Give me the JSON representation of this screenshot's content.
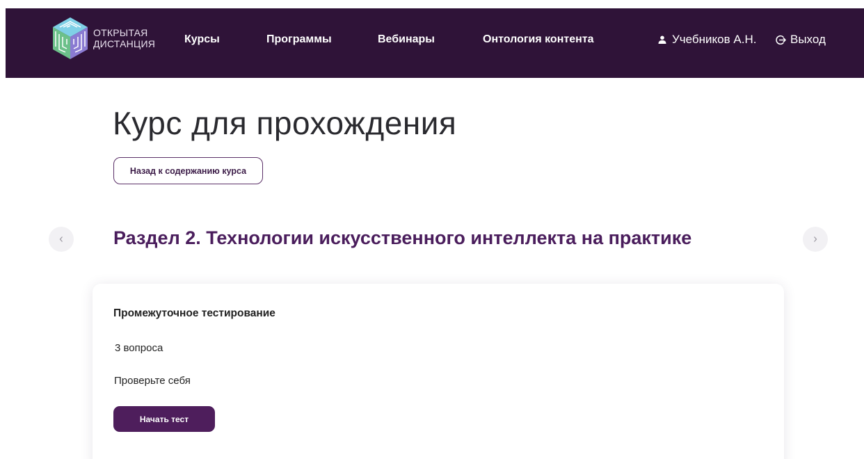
{
  "header": {
    "logo_line1": "Открытая",
    "logo_line2": "дистанция",
    "nav": [
      "Курсы",
      "Программы",
      "Вебинары",
      "Онтология контента"
    ],
    "user_name": "Учебников А.Н.",
    "logout_label": "Выход",
    "background": "#2f1338"
  },
  "page": {
    "title": "Курс для прохождения",
    "back_label": "Назад к содержанию курса",
    "prev_arrow": "‹",
    "next_arrow": "›"
  },
  "section": {
    "title": "Раздел 2. Технологии искусственного интеллекта на практике",
    "accent": "#4a1d5c"
  },
  "card": {
    "title": "Промежуточное тестирование",
    "count": "3 вопроса",
    "description": "Проверьте себя",
    "button_label": "Начать тест",
    "button_color": "#4e1e5c"
  },
  "icons": {
    "logo": "cube-logo-icon",
    "user": "user-icon",
    "logout": "logout-icon",
    "prev": "chevron-left-icon",
    "next": "chevron-right-icon"
  }
}
